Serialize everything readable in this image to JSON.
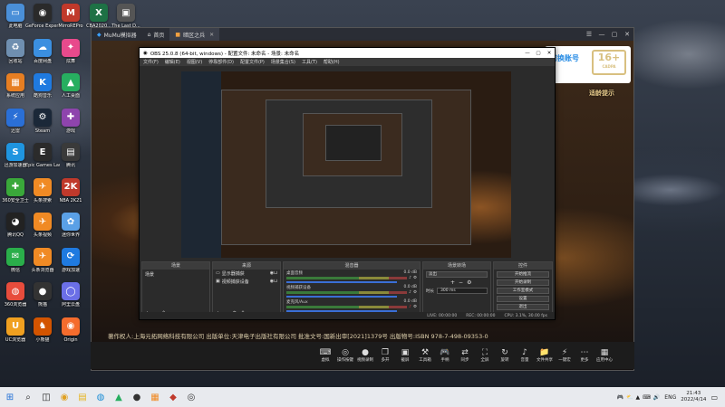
{
  "desktop_icons": [
    {
      "label": "此电脑",
      "icon": "computer-icon",
      "color": "#4a8fd8",
      "glyph": "▭"
    },
    {
      "label": "GeForce Experience",
      "icon": "geforce-icon",
      "color": "#2a2a2a",
      "glyph": "◉"
    },
    {
      "label": "MirroREPro",
      "icon": "mirror-icon",
      "color": "#c0392b",
      "glyph": "M"
    },
    {
      "label": "CBA2020...",
      "icon": "excel-icon",
      "color": "#1e7145",
      "glyph": "X"
    },
    {
      "label": "The Last D...",
      "icon": "game-icon",
      "color": "#555555",
      "glyph": "▣"
    },
    {
      "label": "回收站",
      "icon": "recycle-bin-icon",
      "color": "#6f8fb0",
      "glyph": "♻"
    },
    {
      "label": "百度网盘",
      "icon": "baidu-cloud-icon",
      "color": "#3b8fe0",
      "glyph": "☁"
    },
    {
      "label": "炫舞",
      "icon": "dance-icon",
      "color": "#e84a8c",
      "glyph": "✦"
    },
    {
      "label": "系统应用",
      "icon": "apps-icon",
      "color": "#e67e22",
      "glyph": "▦"
    },
    {
      "label": "酷狗音乐",
      "icon": "kugou-icon",
      "color": "#1f7ae0",
      "glyph": "K"
    },
    {
      "label": "人工桌面",
      "icon": "desk-icon",
      "color": "#27ae60",
      "glyph": "▲"
    },
    {
      "label": "迅雷",
      "icon": "thunder-icon",
      "color": "#2a6fd6",
      "glyph": "⚡"
    },
    {
      "label": "Steam",
      "icon": "steam-icon",
      "color": "#1b2838",
      "glyph": "⚙"
    },
    {
      "label": "游戏",
      "icon": "gamepad-icon",
      "color": "#8e44ad",
      "glyph": "✚"
    },
    {
      "label": "迅游加速器",
      "icon": "accelerator-icon",
      "color": "#1f95e0",
      "glyph": "S"
    },
    {
      "label": "Epic Games Launcher",
      "icon": "epic-icon",
      "color": "#2b2b2b",
      "glyph": "E"
    },
    {
      "label": "腾讯",
      "icon": "tencent-icon",
      "color": "#3a3a3a",
      "glyph": "▤"
    },
    {
      "label": "360安全卫士",
      "icon": "shield-360-icon",
      "color": "#3aa83a",
      "glyph": "✚"
    },
    {
      "label": "头条搜索",
      "icon": "toutiao-icon",
      "color": "#f08a24",
      "glyph": "✈"
    },
    {
      "label": "NBA 2K21",
      "icon": "nba-icon",
      "color": "#c0392b",
      "glyph": "2K"
    },
    {
      "label": "腾讯QQ",
      "icon": "qq-icon",
      "color": "#222222",
      "glyph": "◕"
    },
    {
      "label": "头条视频",
      "icon": "video-icon",
      "color": "#f08a24",
      "glyph": "✈"
    },
    {
      "label": "迷你世界",
      "icon": "mini-world-icon",
      "color": "#5aa0e6",
      "glyph": "✿"
    },
    {
      "label": "微信",
      "icon": "wechat-icon",
      "color": "#2aae4a",
      "glyph": "✉"
    },
    {
      "label": "头条浏览器",
      "icon": "browser-icon",
      "color": "#f08a24",
      "glyph": "✈"
    },
    {
      "label": "游戏加速",
      "icon": "speed-icon",
      "color": "#1f7ae0",
      "glyph": "⟳"
    },
    {
      "label": "360浏览器",
      "icon": "browser-360-icon",
      "color": "#e74c3c",
      "glyph": "◍"
    },
    {
      "label": "熊猫",
      "icon": "panda-icon",
      "color": "#333333",
      "glyph": "●"
    },
    {
      "label": "阿里云盘",
      "icon": "aliyun-icon",
      "color": "#6b6fe6",
      "glyph": "◯"
    },
    {
      "label": "UC浏览器",
      "icon": "uc-icon",
      "color": "#f0a020",
      "glyph": "U"
    },
    {
      "label": "小熊猫",
      "icon": "red-panda-icon",
      "color": "#d35400",
      "glyph": "♞"
    },
    {
      "label": "Origin",
      "icon": "origin-icon",
      "color": "#f56c2d",
      "glyph": "◉"
    }
  ],
  "mumu": {
    "app_name": "MuMu模拟器",
    "tabs": [
      {
        "label": "首页",
        "icon": "home-icon",
        "active": false
      },
      {
        "label": "暗区之兵",
        "icon": "game-tab-icon",
        "active": true
      }
    ],
    "controls": [
      "☰",
      "—",
      "▢",
      "✕"
    ],
    "toolbar": [
      {
        "label": "虚拟",
        "glyph": "⌨",
        "icon": "keyboard-icon"
      },
      {
        "label": "操作按键",
        "glyph": "◎",
        "icon": "keymap-icon"
      },
      {
        "label": "视频录制",
        "glyph": "●",
        "icon": "record-icon"
      },
      {
        "label": "多开",
        "glyph": "❐",
        "icon": "multi-icon"
      },
      {
        "label": "截屏",
        "glyph": "▣",
        "icon": "screenshot-icon"
      },
      {
        "label": "工具箱",
        "glyph": "⚒",
        "icon": "toolbox-icon"
      },
      {
        "label": "手柄",
        "glyph": "🎮",
        "icon": "gamepad-tool-icon"
      },
      {
        "label": "同步",
        "glyph": "⇄",
        "icon": "sync-icon"
      },
      {
        "label": "全屏",
        "glyph": "⛶",
        "icon": "fullscreen-icon"
      },
      {
        "label": "旋转",
        "glyph": "↻",
        "icon": "rotate-icon"
      },
      {
        "label": "音量",
        "glyph": "♪",
        "icon": "volume-icon"
      },
      {
        "label": "文件共享",
        "glyph": "📁",
        "icon": "share-icon"
      },
      {
        "label": "一键宏",
        "glyph": "⚡",
        "icon": "macro-icon"
      },
      {
        "label": "更多",
        "glyph": "⋯",
        "icon": "more-icon"
      },
      {
        "label": "应用中心",
        "glyph": "▦",
        "icon": "app-center-icon"
      }
    ]
  },
  "obs": {
    "title": "OBS 25.0.8 (64-bit, windows) - 配置文件: 未命名 - 场景: 未命名",
    "menu": [
      "文件(F)",
      "编辑(E)",
      "视图(V)",
      "停靠部件(D)",
      "配置文件(P)",
      "场景集合(S)",
      "工具(T)",
      "帮助(H)"
    ],
    "docks": {
      "scenes": {
        "title": "场景",
        "items": [
          "场景"
        ]
      },
      "sources": {
        "title": "来源",
        "items": [
          "显示器捕获",
          "视频捕获设备"
        ]
      },
      "mixer": {
        "title": "混音器",
        "channels": [
          {
            "name": "桌面音频",
            "db": "0.0 dB"
          },
          {
            "name": "视频捕获设备",
            "db": "0.0 dB"
          },
          {
            "name": "麦克风/Aux",
            "db": "0.0 dB"
          }
        ]
      },
      "transitions": {
        "title": "场景转场",
        "type": "淡出",
        "duration_label": "时长",
        "duration": "300 ms"
      },
      "controls": {
        "title": "控件",
        "buttons": [
          "开始推流",
          "开始录制",
          "工作室模式",
          "设置",
          "退出"
        ]
      }
    },
    "status": [
      "LIVE: 00:00:00",
      "REC: 00:00:00",
      "CPU: 3.1%, 30.00 fps"
    ]
  },
  "overlay": {
    "switch_account": "切换账号",
    "age_rating": "16+",
    "age_subtext": "CADPA",
    "age_notice": "适龄提示"
  },
  "license_text": "著作权人:上海元拓网络科技有限公司 出版单位:天津电子出版社有限公司 批准文号:国新出审[2021]1379号 出版物号:ISBN 978-7-498-09353-0",
  "taskbar": {
    "apps": [
      {
        "glyph": "⊞",
        "icon": "windows-start-icon",
        "color": "#1f6fd6"
      },
      {
        "glyph": "⌕",
        "icon": "search-icon",
        "color": "#222222"
      },
      {
        "glyph": "◫",
        "icon": "task-view-icon",
        "color": "#222222"
      },
      {
        "glyph": "◉",
        "icon": "chrome-icon",
        "color": "#e0a020"
      },
      {
        "glyph": "▤",
        "icon": "file-explorer-icon",
        "color": "#e6b422"
      },
      {
        "glyph": "◍",
        "icon": "edge-icon",
        "color": "#1f8fd6"
      },
      {
        "glyph": "▲",
        "icon": "app-icon",
        "color": "#27ae60"
      },
      {
        "glyph": "●",
        "icon": "obs-taskbar-icon",
        "color": "#333333"
      },
      {
        "glyph": "▦",
        "icon": "mumu-taskbar-icon",
        "color": "#f08a24"
      },
      {
        "glyph": "◆",
        "icon": "game-taskbar-icon",
        "color": "#c0392b"
      },
      {
        "glyph": "◎",
        "icon": "obs-active-icon",
        "color": "#333333"
      }
    ],
    "tray_icons": [
      "🎮",
      "⛅",
      "▲",
      "⌨",
      "🔊"
    ],
    "lang": "ENG",
    "time": "21:43",
    "date": "2022/4/14"
  }
}
